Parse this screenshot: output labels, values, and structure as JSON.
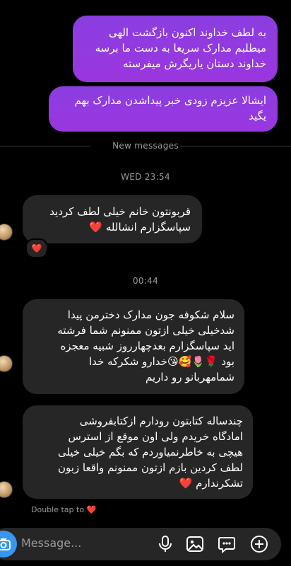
{
  "thread": {
    "sent_1": "به لطف خداوند اکنون بازگشت الهی\nمیطلبم مدارک سریعا به دست ما برسه\nخداوند دستان یاریگرش میفرسته",
    "sent_2": "ایشالا عزیزم زودی خبر پیداشدن مدارک بهم\nیگید",
    "new_messages_label": "New messages",
    "timestamp_1": "WED 23:54",
    "recv_1": "قربونتون خانم خیلی لطف کردید\nسپاسگزارم انشالله ❤️",
    "recv_1_reaction": "❤️",
    "timestamp_2": "00:44",
    "recv_2": "سلام شکوفه جون مدارک دخترمن پیدا\nشدخیلی خیلی ازتون ممنونم  شما فرشته\nاید سپاسگزارم بعدچهارروز شبیه معجزه\nبود 🌹🌷🥰😘خدارو شکرکه خدا\nشمامهربانو  رو داریم",
    "recv_3": "چندساله کتابتون رودارم ازکتابفروشی\nامادگاه  خریدم ولی  اون موقع از استرس\nهیچی به خاطرنمیاوردم که بگم خیلی خیلی\nلطف کردین بازم ازتون ممنونم واقعا زبون\nتشکرندارم ❤️",
    "double_tap_hint": "Double tap to ❤️"
  },
  "composer": {
    "placeholder": "Message...",
    "icons": [
      "camera-icon",
      "microphone-icon",
      "gallery-icon",
      "sticker-icon",
      "plus-icon"
    ]
  },
  "colors": {
    "background": "#000000",
    "sent_bubble": "#8a3ee0",
    "received_bubble": "#262626",
    "camera_button": "#3797f0",
    "muted_text": "#9a9a9a"
  }
}
